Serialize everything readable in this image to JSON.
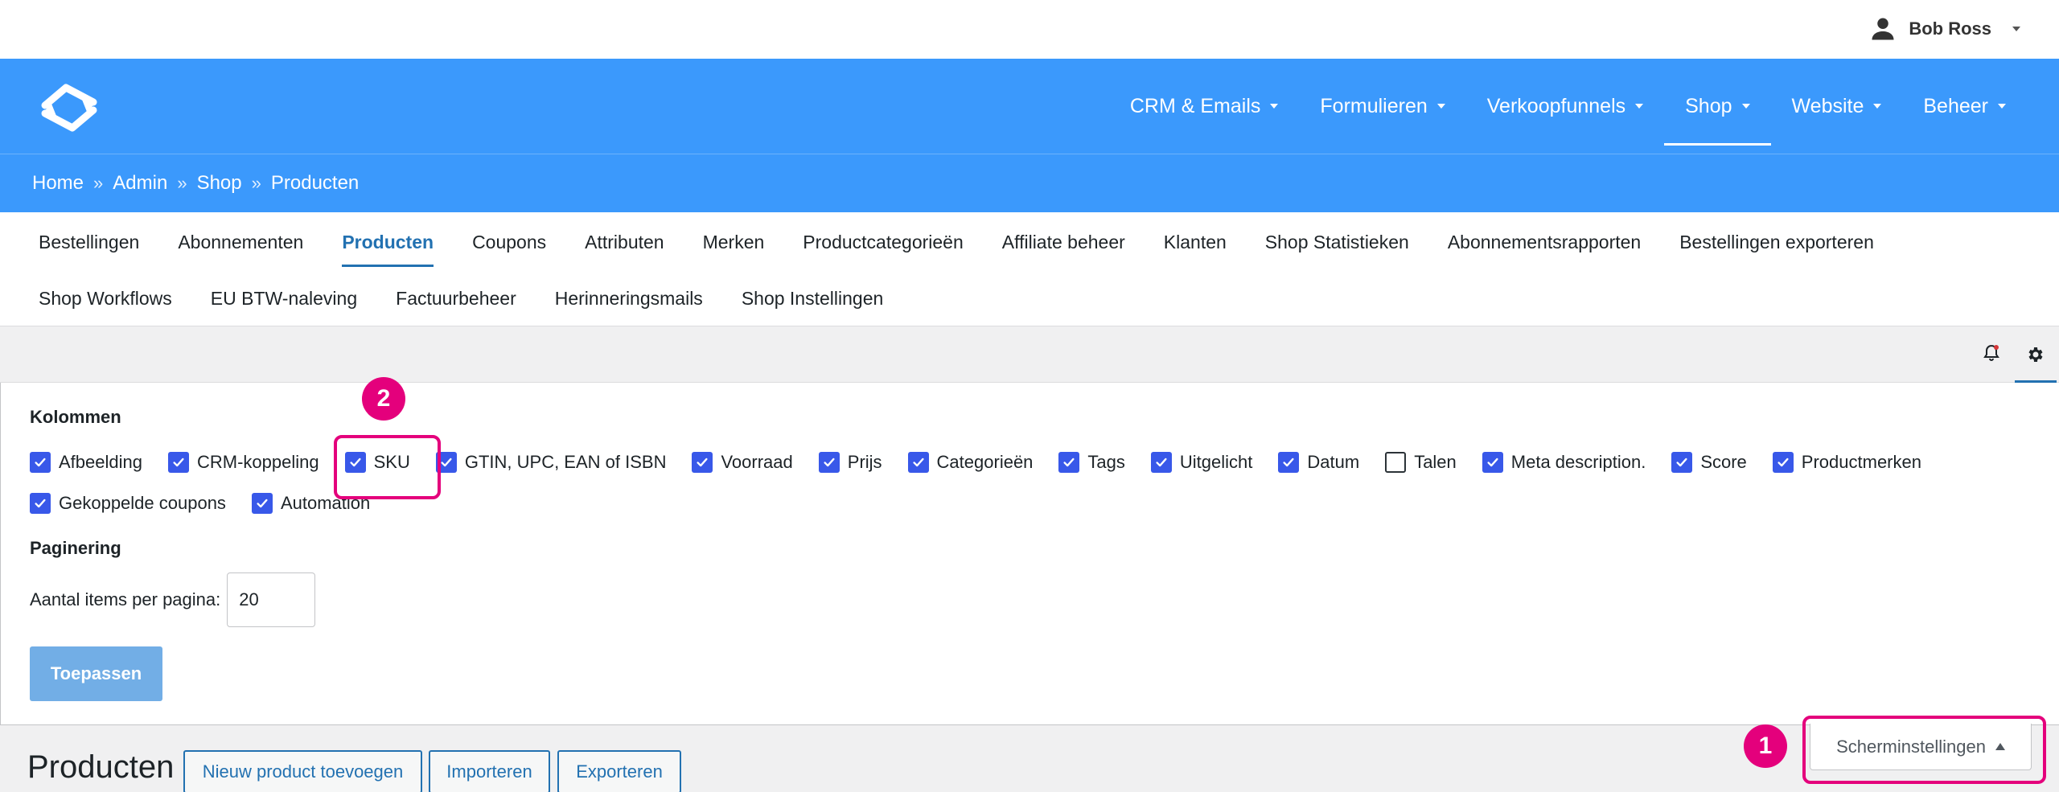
{
  "user": {
    "name": "Bob Ross"
  },
  "main_nav": [
    {
      "label": "CRM & Emails",
      "active": false
    },
    {
      "label": "Formulieren",
      "active": false
    },
    {
      "label": "Verkoopfunnels",
      "active": false
    },
    {
      "label": "Shop",
      "active": true
    },
    {
      "label": "Website",
      "active": false
    },
    {
      "label": "Beheer",
      "active": false
    }
  ],
  "breadcrumb": [
    "Home",
    "Admin",
    "Shop",
    "Producten"
  ],
  "breadcrumb_sep": "»",
  "sub_nav_row1": [
    "Bestellingen",
    "Abonnementen",
    "Producten",
    "Coupons",
    "Attributen",
    "Merken",
    "Productcategorieën",
    "Affiliate beheer",
    "Klanten",
    "Shop Statistieken",
    "Abonnementsrapporten",
    "Bestellingen exporteren"
  ],
  "sub_nav_row2": [
    "Shop Workflows",
    "EU BTW-naleving",
    "Factuurbeheer",
    "Herinneringsmails",
    "Shop Instellingen"
  ],
  "sub_nav_active": "Producten",
  "screen_options": {
    "columns_title": "Kolommen",
    "columns_row1": [
      {
        "label": "Afbeelding",
        "checked": true
      },
      {
        "label": "CRM-koppeling",
        "checked": true
      },
      {
        "label": "SKU",
        "checked": true
      },
      {
        "label": "GTIN, UPC, EAN of ISBN",
        "checked": true
      },
      {
        "label": "Voorraad",
        "checked": true
      },
      {
        "label": "Prijs",
        "checked": true
      },
      {
        "label": "Categorieën",
        "checked": true
      },
      {
        "label": "Tags",
        "checked": true
      },
      {
        "label": "Uitgelicht",
        "checked": true
      },
      {
        "label": "Datum",
        "checked": true
      },
      {
        "label": "Talen",
        "checked": false
      },
      {
        "label": "Meta description.",
        "checked": true
      },
      {
        "label": "Score",
        "checked": true
      },
      {
        "label": "Productmerken",
        "checked": true
      }
    ],
    "columns_row2": [
      {
        "label": "Gekoppelde coupons",
        "checked": true
      },
      {
        "label": "Automation",
        "checked": true
      }
    ],
    "pagination_title": "Paginering",
    "per_page_label": "Aantal items per pagina:",
    "per_page_value": "20",
    "apply_label": "Toepassen"
  },
  "page": {
    "title": "Producten",
    "buttons": [
      "Nieuw product toevoegen",
      "Importeren",
      "Exporteren"
    ]
  },
  "screen_options_toggle": "Scherminstellingen",
  "annotations": [
    {
      "number": "1",
      "target": "Scherminstellingen"
    },
    {
      "number": "2",
      "target": "SKU"
    }
  ],
  "colors": {
    "header_blue": "#3b99fc",
    "checkbox_blue": "#3858e9",
    "link_blue": "#2271b1",
    "annotation_pink": "#e4007c",
    "apply_button": "#72aee6"
  }
}
